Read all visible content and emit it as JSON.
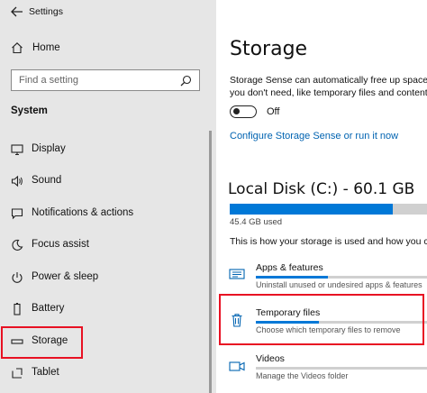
{
  "window": {
    "title": "Settings"
  },
  "sidebar": {
    "home_label": "Home",
    "search_placeholder": "Find a setting",
    "section_title": "System",
    "items": [
      {
        "label": "Display",
        "icon": "display-icon"
      },
      {
        "label": "Sound",
        "icon": "sound-icon"
      },
      {
        "label": "Notifications & actions",
        "icon": "notifications-icon"
      },
      {
        "label": "Focus assist",
        "icon": "focus-assist-icon"
      },
      {
        "label": "Power & sleep",
        "icon": "power-icon"
      },
      {
        "label": "Battery",
        "icon": "battery-icon"
      },
      {
        "label": "Storage",
        "icon": "storage-icon",
        "highlighted": true
      },
      {
        "label": "Tablet",
        "icon": "tablet-icon"
      }
    ]
  },
  "main": {
    "title": "Storage",
    "description_line1": "Storage Sense can automatically free up space b",
    "description_line2": "you don't need, like temporary files and content",
    "toggle_state": "Off",
    "configure_link": "Configure Storage Sense or run it now",
    "disk": {
      "title": "Local Disk (C:) - 60.1 GB",
      "used_label": "45.4 GB used",
      "used_fraction": 0.755,
      "description": "This is how your storage is used and how you ca"
    },
    "categories": [
      {
        "label": "Apps & features",
        "sub": "Uninstall unused or undesired apps & features",
        "fraction": 0.42,
        "icon": "apps-features-icon"
      },
      {
        "label": "Temporary files",
        "sub": "Choose which temporary files to remove",
        "fraction": 0.37,
        "icon": "trash-icon",
        "highlighted": true
      },
      {
        "label": "Videos",
        "sub": "Manage the Videos folder",
        "fraction": 0.0,
        "icon": "videos-icon"
      }
    ]
  },
  "colors": {
    "accent": "#0078d7",
    "link": "#0063b1",
    "highlight": "#e81123",
    "sidebar_bg": "#e6e6e6"
  }
}
